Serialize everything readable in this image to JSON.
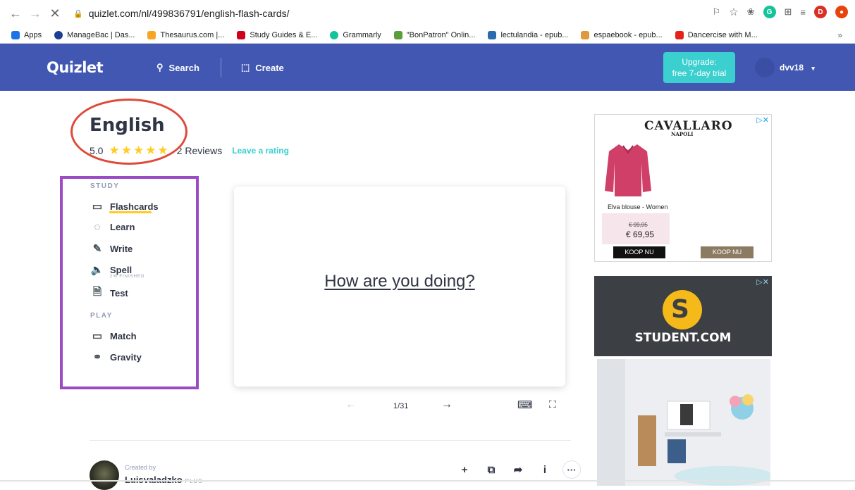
{
  "browser": {
    "url": "quizlet.com/nl/499836791/english-flash-cards/",
    "bookmarks": [
      {
        "label": "Apps",
        "color": "#1a73e8"
      },
      {
        "label": "ManageBac | Das...",
        "color": "#1c3f94"
      },
      {
        "label": "Thesaurus.com |...",
        "color": "#f5a623"
      },
      {
        "label": "Study Guides & E...",
        "color": "#d0021b"
      },
      {
        "label": "Grammarly",
        "color": "#15c39a"
      },
      {
        "label": "\"BonPatron\" Onlin...",
        "color": "#5a9e3a"
      },
      {
        "label": "lectulandia - epub...",
        "color": "#2b6cb0"
      },
      {
        "label": "espaebook - epub...",
        "color": "#e09a3e"
      },
      {
        "label": "Dancercise with M...",
        "color": "#e62117"
      }
    ],
    "more_label": "»"
  },
  "header": {
    "logo": "Quizlet",
    "search_label": "Search",
    "create_label": "Create",
    "upgrade_line1": "Upgrade:",
    "upgrade_line2": "free 7-day trial",
    "username": "dvv18",
    "caret": "▾"
  },
  "set": {
    "title": "English",
    "rating_value": "5.0",
    "stars": 5,
    "reviews": "2 Reviews",
    "leave_rating": "Leave a rating"
  },
  "sidebar": {
    "study_label": "STUDY",
    "play_label": "PLAY",
    "study_items": [
      {
        "label": "Flashcards",
        "icon": "flashcards-icon"
      },
      {
        "label": "Learn",
        "icon": "learn-icon"
      },
      {
        "label": "Write",
        "icon": "write-icon"
      },
      {
        "label": "Spell",
        "icon": "spell-icon"
      },
      {
        "label": "Test",
        "icon": "test-icon"
      }
    ],
    "spell_progress": "2% FINISHED",
    "play_items": [
      {
        "label": "Match",
        "icon": "match-icon"
      },
      {
        "label": "Gravity",
        "icon": "gravity-icon"
      }
    ]
  },
  "card": {
    "text": "How are you doing?",
    "counter": "1/31"
  },
  "creator": {
    "created_by": "Created by",
    "name": "Luisvaladzko",
    "badge": "PLUS"
  },
  "ads": {
    "ad1": {
      "brand": "CAVALLARO",
      "brand_sub": "NAPOLI",
      "product": "Elva blouse - Women",
      "old_price": "€ 99,95",
      "new_price": "€ 69,95",
      "cta1": "KOOP NU",
      "cta2": "KOOP NU"
    },
    "ad2": {
      "brand": "STUDENT.COM"
    }
  },
  "colors": {
    "header_bg": "#4257b2",
    "upgrade_bg": "#3ccfcf",
    "star": "#ffcd1f",
    "annotation_red": "#de4a3a",
    "annotation_purple": "#9b4bc4"
  }
}
